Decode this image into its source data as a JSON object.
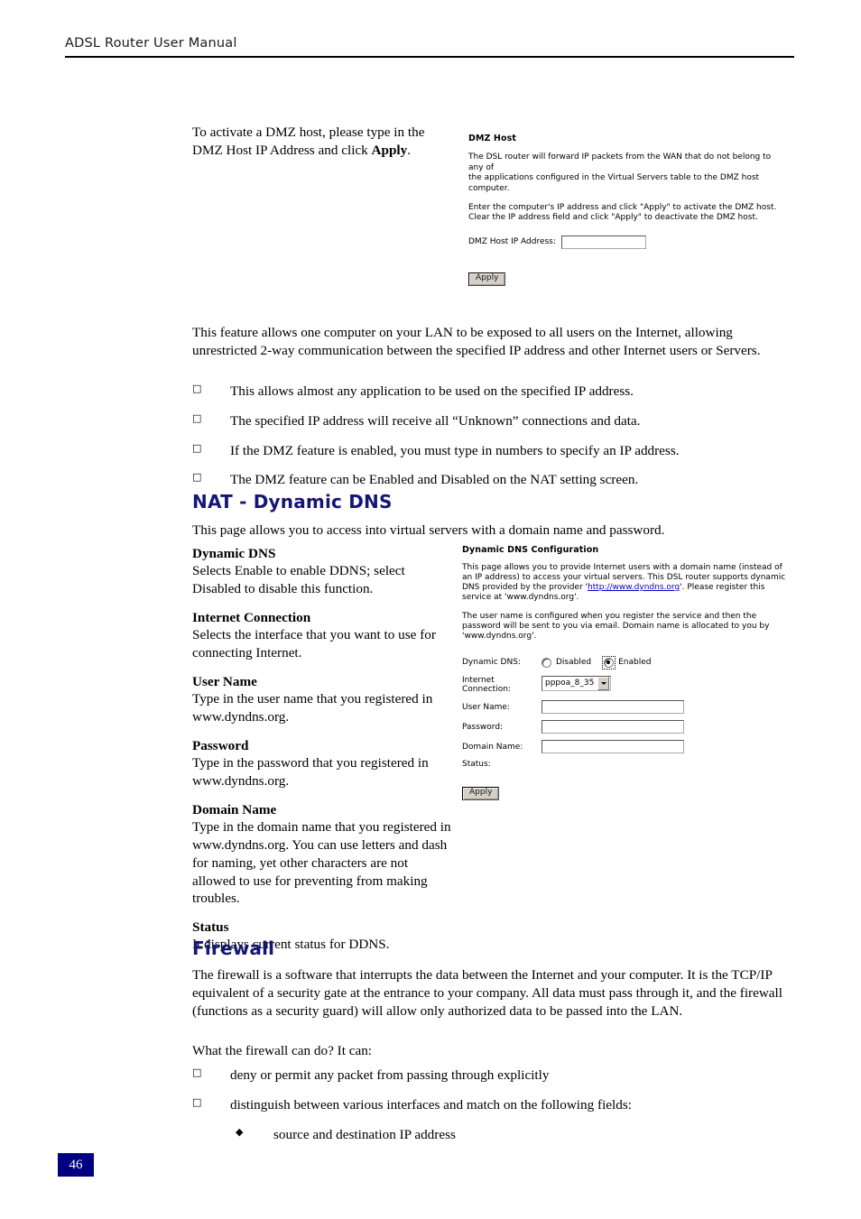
{
  "header": {
    "title": "ADSL Router User Manual"
  },
  "dmz_intro": {
    "line_a": "To activate a DMZ host, please type in the",
    "line_b_pre": "DMZ Host IP Address and click ",
    "line_b_bold": "Apply",
    "line_b_post": "."
  },
  "dmz_shot": {
    "title": "DMZ Host",
    "para1": "The DSL router will forward IP packets from the WAN that do not belong to any of\nthe applications configured in the Virtual Servers table to the DMZ host computer.",
    "para2": "Enter the computer's IP address and click \"Apply\" to activate the DMZ host.\nClear the IP address field and click \"Apply\" to deactivate the DMZ host.",
    "field_label": "DMZ Host IP Address:",
    "field_value": "",
    "apply_label": "Apply"
  },
  "dmz_body": {
    "paragraph": "This feature allows one computer on your LAN to be exposed to all users on the Internet, allowing unrestricted 2-way communication between the specified IP address and other Internet users or Servers.",
    "bullets": [
      "This allows almost any application to be used on the specified IP address.",
      "The specified IP address will receive all “Unknown” connections and data.",
      "If the DMZ feature is enabled, you must type in numbers to specify an IP address.",
      "The DMZ feature can be Enabled and Disabled on the NAT setting screen."
    ],
    "bullet_mark": "□"
  },
  "ddns": {
    "heading": "NAT - Dynamic DNS",
    "intro": "This page allows you to access into virtual servers with a domain name and password.",
    "definitions": [
      {
        "term": "Dynamic DNS",
        "desc": "Selects Enable to enable DDNS; select Disabled to disable this function."
      },
      {
        "term": "Internet Connection",
        "desc": "Selects the interface that you want to use for connecting Internet."
      },
      {
        "term": "User Name",
        "desc": "Type in the user name that you registered in www.dyndns.org."
      },
      {
        "term": "Password",
        "desc": "Type in the password that you registered in www.dyndns.org."
      },
      {
        "term": "Domain Name",
        "desc": "Type in the domain name that you registered in www.dyndns.org. You can use letters and dash for naming, yet other characters are not allowed to use for preventing from making troubles."
      },
      {
        "term": "Status",
        "desc": "It displays current status for DDNS."
      }
    ]
  },
  "ddns_shot": {
    "title": "Dynamic DNS Configuration",
    "para1_a": "This page allows you to provide Internet users with a domain name (instead of an IP address) to access your virtual servers. This DSL router supports dynamic DNS provided by the provider '",
    "link_text": "http://www.dyndns.org",
    "para1_b": "'. Please register this service at 'www.dyndns.org'.",
    "para2": "The user name is configured when you register the service and then the password will be sent to you via email. Domain name is allocated to you by 'www.dyndns.org'.",
    "label_dynamic_dns": "Dynamic DNS:",
    "radio_disabled": "Disabled",
    "radio_enabled": "Enabled",
    "selected_radio": "Enabled",
    "label_internet_connection": "Internet\nConnection:",
    "select_value": "pppoa_8_35",
    "label_user_name": "User Name:",
    "value_user_name": "",
    "label_password": "Password:",
    "value_password": "",
    "label_domain_name": "Domain Name:",
    "value_domain_name": "",
    "label_status": "Status:",
    "value_status": "",
    "apply_label": "Apply"
  },
  "firewall": {
    "heading": "Firewall",
    "paragraph": "The firewall is a software that interrupts the data between the Internet and your computer. It is the TCP/IP equivalent of a security gate at the entrance to your company. All data must pass through it, and the firewall (functions as a security guard) will allow only authorized data to be passed into the LAN.",
    "lead_in": "What the firewall can do? It can:",
    "bullets": [
      "deny or permit any packet from passing through explicitly",
      "distinguish between various interfaces and match on the following fields:"
    ],
    "sub_bullets": [
      "source and destination IP address"
    ],
    "bullet_mark": "□",
    "sub_bullet_mark": "◆"
  },
  "footer": {
    "page_number": "46"
  },
  "colors": {
    "heading": "#151574",
    "page_badge_bg": "#000080",
    "link": "#0000cc"
  }
}
